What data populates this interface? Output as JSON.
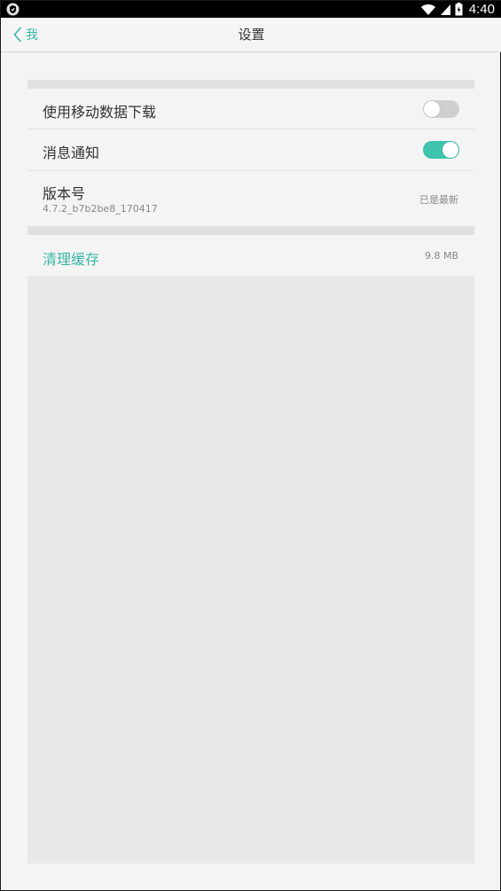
{
  "status_bar": {
    "time": "4:40",
    "left_icon": "shield-notification-icon",
    "icons": [
      "wifi-icon",
      "signal-icon",
      "battery-icon"
    ]
  },
  "nav": {
    "back_label": "我",
    "title": "设置"
  },
  "settings": {
    "mobile_data_download": {
      "label": "使用移动数据下载",
      "enabled": false
    },
    "notifications": {
      "label": "消息通知",
      "enabled": true
    },
    "version": {
      "label": "版本号",
      "number": "4.7.2_b7b2be8_170417",
      "status": "已是最新"
    },
    "clear_cache": {
      "label": "清理缓存",
      "size": "9.8 MB"
    }
  },
  "colors": {
    "accent": "#3ec3ad",
    "toggle_off": "#cfcfcf",
    "background": "#f4f4f4"
  }
}
